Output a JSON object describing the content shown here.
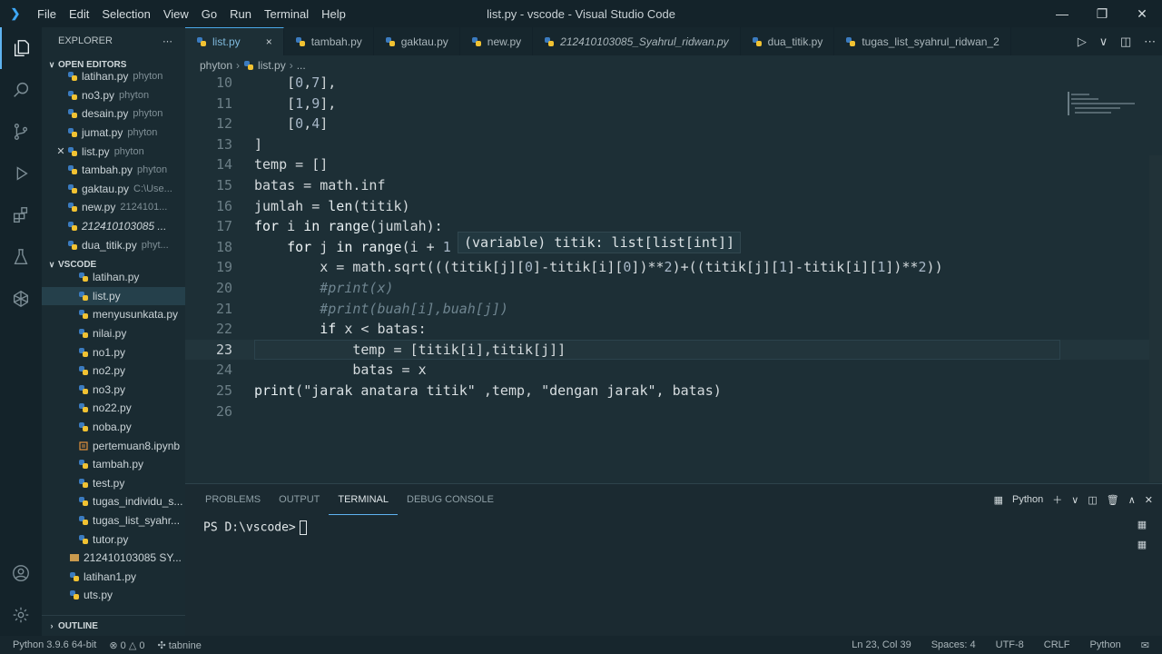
{
  "titlebar": {
    "menu": [
      "File",
      "Edit",
      "Selection",
      "View",
      "Go",
      "Run",
      "Terminal",
      "Help"
    ],
    "title": "list.py - vscode - Visual Studio Code"
  },
  "sidebar": {
    "header": "EXPLORER",
    "open_editors_label": "OPEN EDITORS",
    "open_editors": [
      {
        "name": "latihan.py",
        "desc": "phyton"
      },
      {
        "name": "no3.py",
        "desc": "phyton"
      },
      {
        "name": "desain.py",
        "desc": "phyton"
      },
      {
        "name": "jumat.py",
        "desc": "phyton"
      },
      {
        "name": "list.py",
        "desc": "phyton"
      },
      {
        "name": "tambah.py",
        "desc": "phyton"
      },
      {
        "name": "gaktau.py",
        "desc": "C:\\Use..."
      },
      {
        "name": "new.py",
        "desc": "2124101..."
      },
      {
        "name": "212410103085 ...",
        "desc": ""
      },
      {
        "name": "dua_titik.py",
        "desc": "phyt..."
      }
    ],
    "vscode_label": "VSCODE",
    "vscode_files": [
      "latihan.py",
      "list.py",
      "menyusunkata.py",
      "nilai.py",
      "no1.py",
      "no2.py",
      "no3.py",
      "no22.py",
      "noba.py",
      "pertemuan8.ipynb",
      "tambah.py",
      "test.py",
      "tugas_individu_s...",
      "tugas_list_syahr...",
      "tutor.py",
      "212410103085 SY...",
      "latihan1.py",
      "uts.py"
    ],
    "outline_label": "OUTLINE"
  },
  "tabs": [
    {
      "label": "list.py",
      "close": "×"
    },
    {
      "label": "tambah.py"
    },
    {
      "label": "gaktau.py"
    },
    {
      "label": "new.py"
    },
    {
      "label": "212410103085_Syahrul_ridwan.py"
    },
    {
      "label": "dua_titik.py"
    },
    {
      "label": "tugas_list_syahrul_ridwan_2"
    }
  ],
  "breadcrumb": {
    "folder": "phyton",
    "file": "list.py",
    "more": "..."
  },
  "editor": {
    "line_numbers": [
      "10",
      "11",
      "12",
      "13",
      "14",
      "15",
      "16",
      "17",
      "18",
      "19",
      "20",
      "21",
      "22",
      "23",
      "24",
      "25",
      "26"
    ],
    "hover_text": "(variable) titik: list[list[int]]"
  },
  "panel": {
    "tabs": [
      "PROBLEMS",
      "OUTPUT",
      "TERMINAL",
      "DEBUG CONSOLE"
    ],
    "shell": "Python",
    "prompt": "PS D:\\vscode>"
  },
  "statusbar": {
    "python_version": "Python 3.9.6 64-bit",
    "errors": "0",
    "warnings": "0",
    "tabnine": "tabnine",
    "position": "Ln 23, Col 39",
    "spaces": "Spaces: 4",
    "encoding": "UTF-8",
    "eol": "CRLF",
    "language": "Python"
  }
}
